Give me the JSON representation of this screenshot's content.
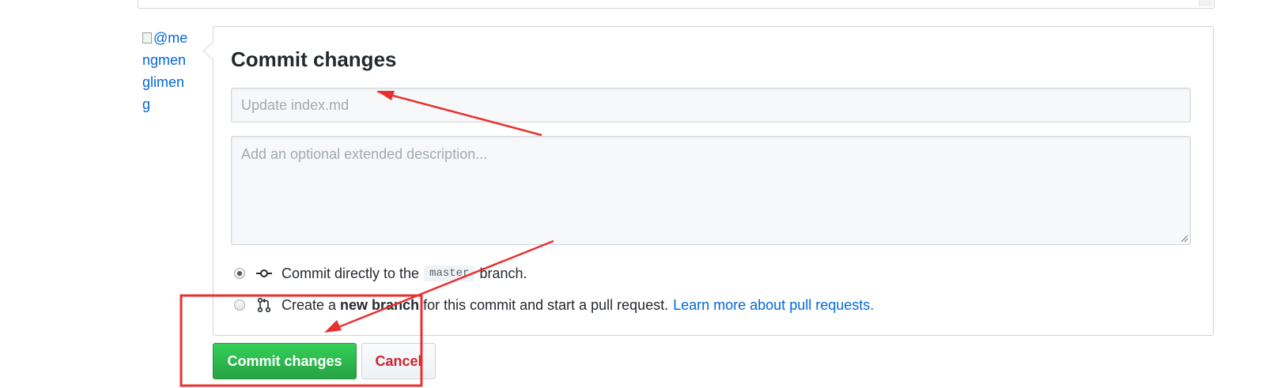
{
  "avatar": {
    "alt_text": "@mengmenglimeng"
  },
  "commit_form": {
    "title": "Commit changes",
    "summary_placeholder": "Update index.md",
    "summary_value": "",
    "description_placeholder": "Add an optional extended description...",
    "description_value": "",
    "options": [
      {
        "selected": true,
        "icon": "git-commit-icon",
        "text_before": "Commit directly to the",
        "branch": "master",
        "text_after": "branch."
      },
      {
        "selected": false,
        "icon": "git-pull-request-icon",
        "text_before": "Create a",
        "bold": "new branch",
        "text_after": "for this commit and start a pull request.",
        "link": "Learn more about pull requests."
      }
    ],
    "buttons": {
      "commit": "Commit changes",
      "cancel": "Cancel"
    }
  },
  "colors": {
    "commit_button": "#2ea44f",
    "cancel_text": "#cb2431",
    "link": "#0366d6",
    "annotation": "#e8312f"
  }
}
